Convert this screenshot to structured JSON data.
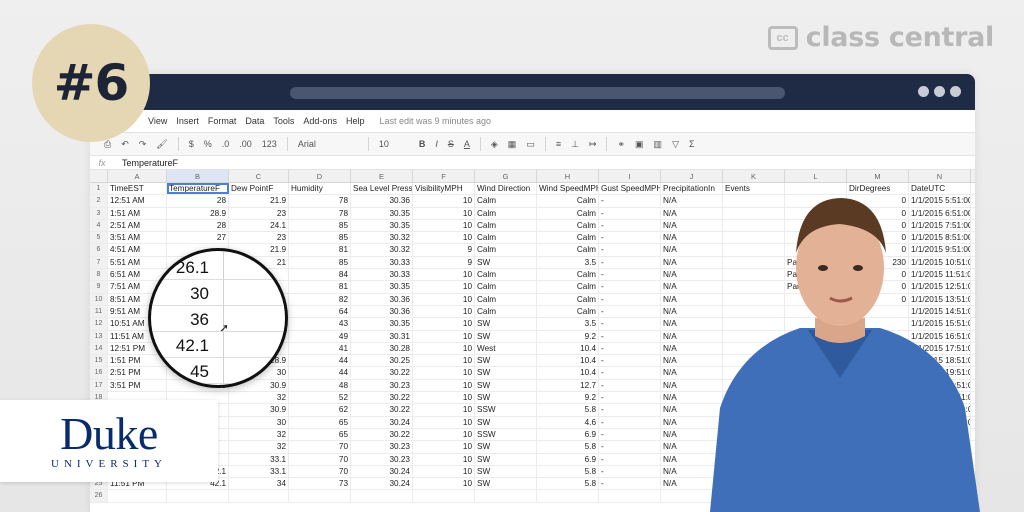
{
  "badge": {
    "text": "#6"
  },
  "brand": {
    "name": "class central",
    "mark": "cc"
  },
  "institution": {
    "name": "Duke",
    "sub": "UNIVERSITY"
  },
  "menu": {
    "items": [
      "View",
      "Insert",
      "Format",
      "Data",
      "Tools",
      "Add-ons",
      "Help"
    ],
    "last_edit": "Last edit was 9 minutes ago"
  },
  "toolbar": {
    "zoom": "123",
    "font": "Arial",
    "size": "10",
    "bold": "B",
    "italic": "I",
    "strike": "S",
    "color": "A",
    "percent": "%",
    "dec_minus": ".0",
    "dec_plus": ".00",
    "sum": "Σ"
  },
  "formula": {
    "fx": "fx",
    "value": "TemperatureF"
  },
  "columns": [
    "A",
    "B",
    "C",
    "D",
    "E",
    "F",
    "G",
    "H",
    "I",
    "J",
    "K",
    "L",
    "M",
    "N"
  ],
  "header_row": [
    "TimeEST",
    "TemperatureF",
    "Dew PointF",
    "Humidity",
    "Sea Level Press",
    "VisibilityMPH",
    "Wind Direction",
    "Wind SpeedMPH",
    "Gust SpeedMPH",
    "PrecipitationIn",
    "Events",
    "",
    "DirDegrees",
    "DateUTC"
  ],
  "rows": [
    [
      "12:51 AM",
      "28",
      "21.9",
      "78",
      "30.36",
      "10",
      "Calm",
      "Calm",
      "-",
      "N/A",
      "",
      "",
      "0",
      "1/1/2015 5:51:00"
    ],
    [
      "1:51 AM",
      "28.9",
      "23",
      "78",
      "30.35",
      "10",
      "Calm",
      "Calm",
      "-",
      "N/A",
      "",
      "",
      "0",
      "1/1/2015 6:51:00"
    ],
    [
      "2:51 AM",
      "28",
      "24.1",
      "85",
      "30.35",
      "10",
      "Calm",
      "Calm",
      "-",
      "N/A",
      "",
      "",
      "0",
      "1/1/2015 7:51:00"
    ],
    [
      "3:51 AM",
      "27",
      "23",
      "85",
      "30.32",
      "10",
      "Calm",
      "Calm",
      "-",
      "N/A",
      "",
      "",
      "0",
      "1/1/2015 8:51:00"
    ],
    [
      "4:51 AM",
      "",
      "21.9",
      "81",
      "30.32",
      "9",
      "Calm",
      "Calm",
      "-",
      "N/A",
      "",
      "",
      "0",
      "1/1/2015 9:51:00"
    ],
    [
      "5:51 AM",
      "",
      "21",
      "85",
      "30.33",
      "9",
      "SW",
      "3.5",
      "-",
      "N/A",
      "",
      "Par",
      "230",
      "1/1/2015 10:51:0"
    ],
    [
      "6:51 AM",
      "",
      "",
      "84",
      "30.33",
      "10",
      "Calm",
      "Calm",
      "-",
      "N/A",
      "",
      "Par",
      "0",
      "1/1/2015 11:51:0"
    ],
    [
      "7:51 AM",
      "",
      "",
      "81",
      "30.35",
      "10",
      "Calm",
      "Calm",
      "-",
      "N/A",
      "",
      "Par",
      "0",
      "1/1/2015 12:51:0"
    ],
    [
      "8:51 AM",
      "",
      "",
      "82",
      "30.36",
      "10",
      "Calm",
      "Calm",
      "-",
      "N/A",
      "",
      "",
      "0",
      "1/1/2015 13:51:0"
    ],
    [
      "9:51 AM",
      "",
      "",
      "64",
      "30.36",
      "10",
      "Calm",
      "Calm",
      "-",
      "N/A",
      "",
      "",
      "",
      "1/1/2015 14:51:0"
    ],
    [
      "10:51 AM",
      "",
      "",
      "43",
      "30.35",
      "10",
      "SW",
      "3.5",
      "-",
      "N/A",
      "",
      "",
      "",
      "1/1/2015 15:51:0"
    ],
    [
      "11:51 AM",
      "",
      "",
      "49",
      "30.31",
      "10",
      "SW",
      "9.2",
      "-",
      "N/A",
      "",
      "",
      "",
      "1/1/2015 16:51:0"
    ],
    [
      "12:51 PM",
      "",
      "",
      "41",
      "30.28",
      "10",
      "West",
      "10.4",
      "-",
      "N/A",
      "",
      "",
      "",
      "1/1/2015 17:51:0"
    ],
    [
      "1:51 PM",
      "",
      "28.9",
      "44",
      "30.25",
      "10",
      "SW",
      "10.4",
      "-",
      "N/A",
      "",
      "",
      "",
      "1/1/2015 18:51:0"
    ],
    [
      "2:51 PM",
      "",
      "30",
      "44",
      "30.22",
      "10",
      "SW",
      "10.4",
      "-",
      "N/A",
      "",
      "",
      "",
      "1/1/2015 19:51:0"
    ],
    [
      "3:51 PM",
      "50",
      "30.9",
      "48",
      "30.23",
      "10",
      "SW",
      "12.7",
      "-",
      "N/A",
      "",
      "",
      "",
      "1/1/2015 20:51:0"
    ],
    [
      "",
      "",
      "32",
      "52",
      "30.22",
      "10",
      "SW",
      "9.2",
      "-",
      "N/A",
      "",
      "",
      "",
      "1/1/2015 21:51:0"
    ],
    [
      "",
      "",
      "30.9",
      "62",
      "30.22",
      "10",
      "SSW",
      "5.8",
      "-",
      "N/A",
      "",
      "",
      "",
      "1/1/2015 22:51:0"
    ],
    [
      "",
      "",
      "30",
      "65",
      "30.24",
      "10",
      "SW",
      "4.6",
      "-",
      "N/A",
      "",
      "",
      "",
      "1/1/2015 23:51:0"
    ],
    [
      "",
      "",
      "32",
      "65",
      "30.22",
      "10",
      "SSW",
      "6.9",
      "-",
      "N/A",
      "",
      "",
      "",
      "1/2/2015 0:51:0"
    ],
    [
      "",
      "",
      "32",
      "70",
      "30.23",
      "10",
      "SW",
      "5.8",
      "-",
      "N/A",
      "",
      "",
      "",
      "1/2/2015 1:51:0"
    ],
    [
      "",
      "",
      "33.1",
      "70",
      "30.23",
      "10",
      "SW",
      "6.9",
      "-",
      "N/A",
      "",
      "",
      "",
      "1/2/2015 2:51:0"
    ],
    [
      "10:51 PM",
      "42.1",
      "33.1",
      "70",
      "30.24",
      "10",
      "SW",
      "5.8",
      "-",
      "N/A",
      "",
      "",
      "",
      "1/2/2015 3:51:0"
    ],
    [
      "11:51 PM",
      "42.1",
      "34",
      "73",
      "30.24",
      "10",
      "SW",
      "5.8",
      "-",
      "N/A",
      "",
      "",
      "",
      "1/2/2015 4:51:0"
    ],
    [
      "",
      "",
      "",
      "",
      "",
      "",
      "",
      "",
      "",
      "",
      "",
      "",
      "",
      ""
    ]
  ],
  "magnifier": {
    "values": [
      "26.1",
      "30",
      "36",
      "42.1",
      "45"
    ]
  }
}
